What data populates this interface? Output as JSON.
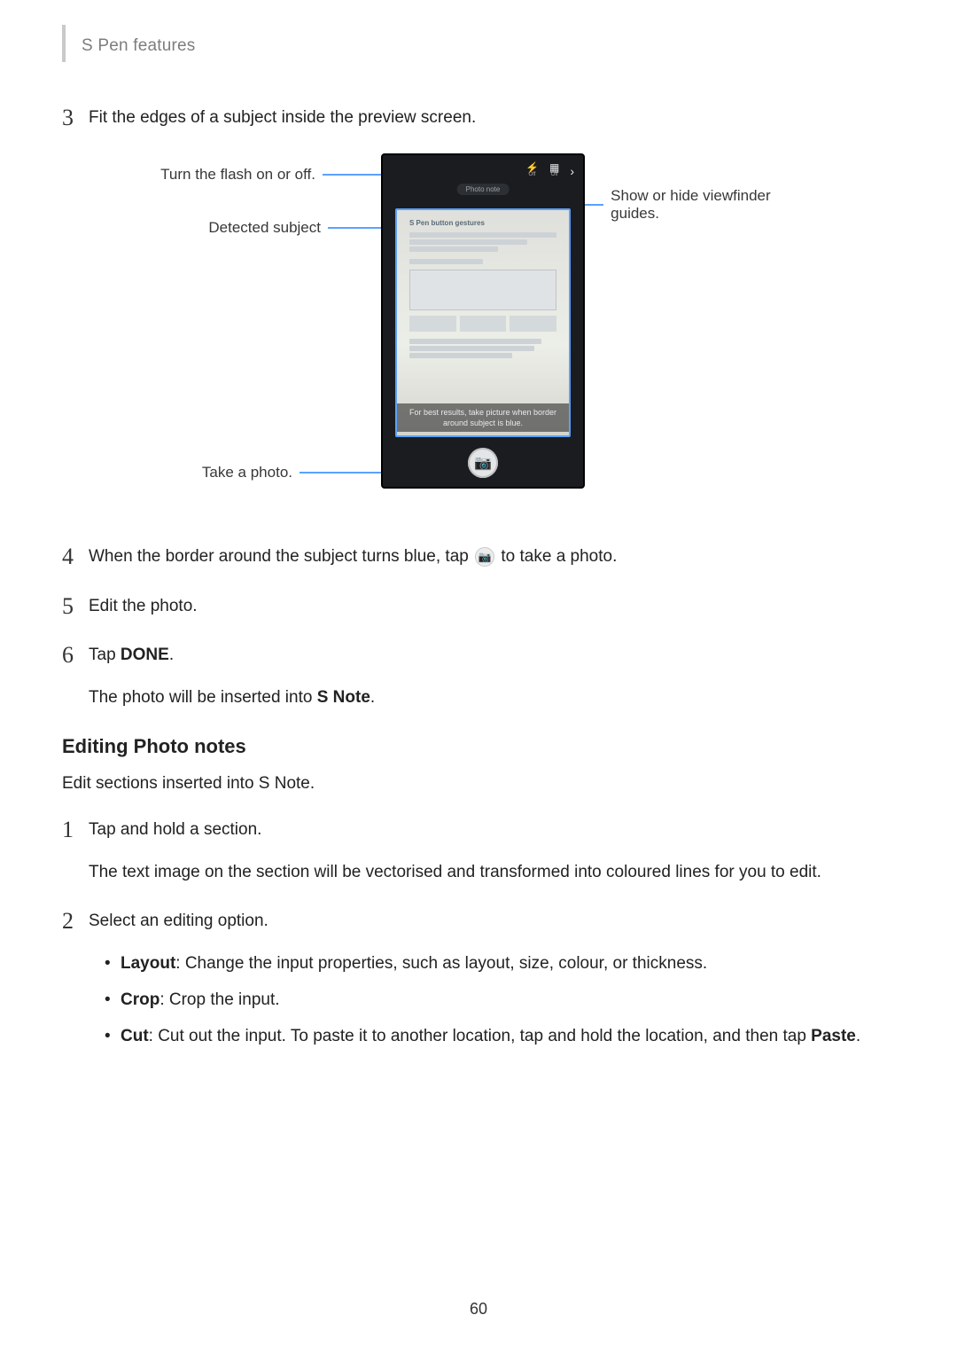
{
  "header": {
    "title": "S Pen features"
  },
  "pageNumber": "60",
  "diagram": {
    "callouts": {
      "flash": "Turn the flash on or off.",
      "subject": "Detected subject",
      "shutter": "Take a photo.",
      "guides": "Show or hide viewfinder guides."
    },
    "phone": {
      "flashStateLabel": "Off",
      "guidesStateLabel": "Off",
      "modeLabel": "Photo note",
      "docTitle": "S Pen button gestures",
      "hint": "For best results, take picture when border around subject is blue."
    }
  },
  "steps_a": [
    {
      "num": "3",
      "text": "Fit the edges of a subject inside the preview screen."
    }
  ],
  "steps_b": [
    {
      "num": "4",
      "text_before": "When the border around the subject turns blue, tap ",
      "text_after": " to take a photo."
    },
    {
      "num": "5",
      "text": "Edit the photo."
    },
    {
      "num": "6",
      "line1_before": "Tap ",
      "line1_bold": "DONE",
      "line1_after": ".",
      "line2_before": "The photo will be inserted into ",
      "line2_bold": "S Note",
      "line2_after": "."
    }
  ],
  "section2": {
    "title": "Editing Photo notes",
    "lead": "Edit sections inserted into S Note.",
    "steps": [
      {
        "num": "1",
        "line1": "Tap and hold a section.",
        "line2": "The text image on the section will be vectorised and transformed into coloured lines for you to edit."
      },
      {
        "num": "2",
        "line1": "Select an editing option.",
        "options": [
          {
            "bold": "Layout",
            "rest": ": Change the input properties, such as layout, size, colour, or thickness."
          },
          {
            "bold": "Crop",
            "rest": ": Crop the input."
          },
          {
            "bold": "Cut",
            "rest_before": ": Cut out the input. To paste it to another location, tap and hold the location, and then tap ",
            "rest_bold": "Paste",
            "rest_after": "."
          }
        ]
      }
    ]
  }
}
